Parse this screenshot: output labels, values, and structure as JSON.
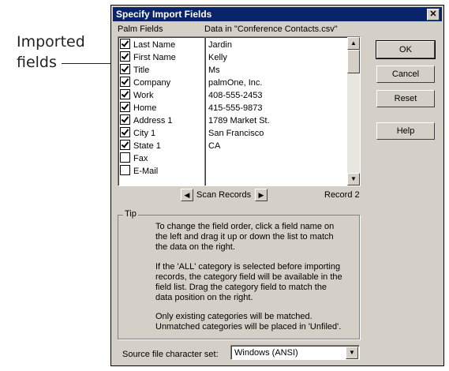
{
  "callout": {
    "line1": "Imported",
    "line2": "fields"
  },
  "dialog": {
    "title": "Specify Import Fields",
    "close_symbol": "✕",
    "palm_fields_label": "Palm Fields",
    "data_label": "Data in \"Conference Contacts.csv\"",
    "fields": [
      {
        "label": "Last Name",
        "checked": true
      },
      {
        "label": "First Name",
        "checked": true
      },
      {
        "label": "Title",
        "checked": true
      },
      {
        "label": "Company",
        "checked": true
      },
      {
        "label": "Work",
        "checked": true
      },
      {
        "label": "Home",
        "checked": true
      },
      {
        "label": "Address 1",
        "checked": true
      },
      {
        "label": "City 1",
        "checked": true
      },
      {
        "label": "State 1",
        "checked": true
      },
      {
        "label": "Fax",
        "checked": false
      },
      {
        "label": "E-Mail",
        "checked": false
      }
    ],
    "data_values": [
      "Jardin",
      "Kelly",
      "Ms",
      "palmOne, Inc.",
      "408-555-2453",
      "415-555-9873",
      "1789 Market St.",
      "San Francisco",
      "CA"
    ],
    "buttons": {
      "ok": "OK",
      "cancel": "Cancel",
      "reset": "Reset",
      "help": "Help"
    },
    "scan_records_label": "Scan Records",
    "record_label": "Record 2",
    "tip": {
      "legend": "Tip",
      "p1": "To change the field order, click a field name on the left and drag it up or down the list to match the data on the right.",
      "p2": "If the 'ALL' category is selected before importing records, the category field will be available in the field list.  Drag the category field to match the data position on the right.",
      "p3": "Only existing categories will be matched. Unmatched categories will be placed in 'Unfiled'."
    },
    "charset_label": "Source file character set:",
    "charset_value": "Windows (ANSI)"
  },
  "icons": {
    "arrow_left": "◀",
    "arrow_right": "▶",
    "arrow_up": "▲",
    "arrow_down": "▼"
  }
}
